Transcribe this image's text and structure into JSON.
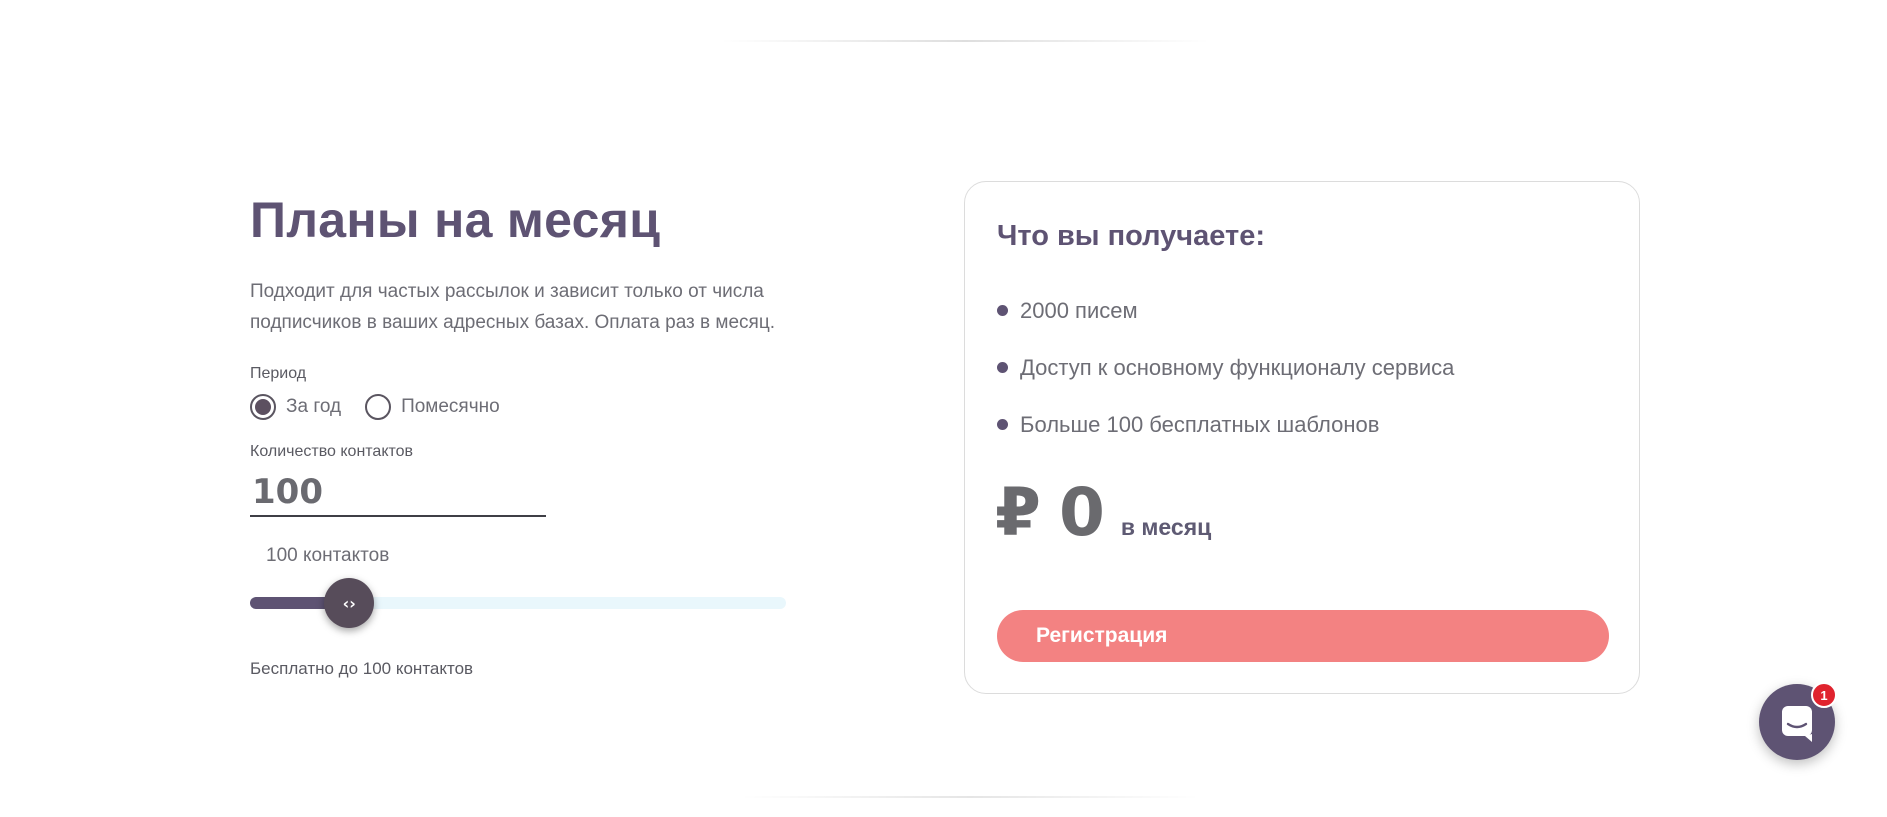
{
  "plans": {
    "title": "Планы на месяц",
    "description_line1": "Подходит для частых рассылок и зависит только от числа",
    "description_line2": "подписчиков в ваших адресных базах. Оплата раз в месяц.",
    "period": {
      "label": "Период",
      "options": [
        {
          "label": "За год",
          "selected": true
        },
        {
          "label": "Помесячно",
          "selected": false
        }
      ]
    },
    "contacts": {
      "label": "Количество контактов",
      "value": "100",
      "count_text": "100 контактов",
      "slider_fraction": 0.04,
      "slider_thumb_glyph": "‹›",
      "free_note": "Бесплатно до 100 контактов"
    }
  },
  "card": {
    "title": "Что вы получаете:",
    "features": [
      "2000 писем",
      "Доступ к основному функционалу сервиса",
      "Больше 100 бесплатных шаблонов"
    ],
    "price": {
      "currency": "₽",
      "amount": "0",
      "period": "в месяц"
    },
    "register_label": "Регистрация"
  },
  "chat": {
    "icon": "chat-icon",
    "badge_count": "1"
  },
  "colors": {
    "accent_purple": "#5e5373",
    "button_coral": "#f38282",
    "badge_red": "#e0232e",
    "slider_track": "#e9f7fc"
  }
}
